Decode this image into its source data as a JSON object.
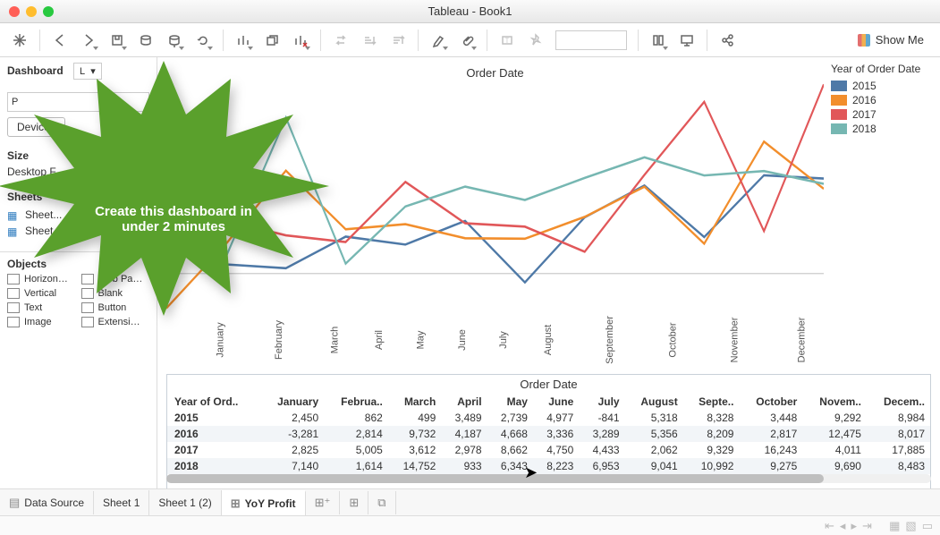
{
  "window": {
    "title": "Tableau - Book1"
  },
  "toolbar": {
    "showme": "Show Me"
  },
  "sidebar": {
    "dashboard_label": "Dashboard",
    "layout_sel": "L",
    "device_btn": "Device .",
    "size_label": "Size",
    "size_value": "Desktop F",
    "sheets_label": "Sheets",
    "sheets": [
      "Sheet...",
      "Sheet 1 (2)"
    ],
    "objects_label": "Objects",
    "objects": [
      "Horizon…",
      "Web Pa…",
      "Vertical",
      "Blank",
      "Text",
      "Button",
      "Image",
      "Extensi…"
    ],
    "preview_label": "P"
  },
  "callout": {
    "text": "Create this dashboard in under 2 minutes"
  },
  "chart_data": {
    "type": "line",
    "title": "Order Date",
    "categories": [
      "January",
      "February",
      "March",
      "April",
      "May",
      "June",
      "July",
      "August",
      "September",
      "October",
      "November",
      "December"
    ],
    "series": [
      {
        "name": "2015",
        "color": "#4e79a7",
        "values": [
          2450,
          862,
          499,
          3489,
          2739,
          4977,
          -841,
          5318,
          8328,
          3448,
          9292,
          8984
        ]
      },
      {
        "name": "2016",
        "color": "#f28e2c",
        "values": [
          -3281,
          2814,
          9732,
          4187,
          4668,
          3336,
          3289,
          5356,
          8209,
          2817,
          12475,
          8017
        ]
      },
      {
        "name": "2017",
        "color": "#e15759",
        "values": [
          2825,
          5005,
          3612,
          2978,
          8662,
          4750,
          4433,
          2062,
          9329,
          16243,
          4011,
          17885
        ]
      },
      {
        "name": "2018",
        "color": "#76b7b2",
        "values": [
          7140,
          1614,
          14752,
          933,
          6343,
          8223,
          6953,
          9041,
          10992,
          9275,
          9690,
          8483
        ]
      }
    ],
    "ylim": [
      -4000,
      18000
    ]
  },
  "table": {
    "title": "Order Date",
    "rowheader": "Year of Ord..",
    "columns": [
      "January",
      "Februa..",
      "March",
      "April",
      "May",
      "June",
      "July",
      "August",
      "Septe..",
      "October",
      "Novem..",
      "Decem.."
    ],
    "rows": [
      {
        "year": "2015",
        "v": [
          "2,450",
          "862",
          "499",
          "3,489",
          "2,739",
          "4,977",
          "-841",
          "5,318",
          "8,328",
          "3,448",
          "9,292",
          "8,984"
        ]
      },
      {
        "year": "2016",
        "v": [
          "-3,281",
          "2,814",
          "9,732",
          "4,187",
          "4,668",
          "3,336",
          "3,289",
          "5,356",
          "8,209",
          "2,817",
          "12,475",
          "8,017"
        ]
      },
      {
        "year": "2017",
        "v": [
          "2,825",
          "5,005",
          "3,612",
          "2,978",
          "8,662",
          "4,750",
          "4,433",
          "2,062",
          "9,329",
          "16,243",
          "4,011",
          "17,885"
        ]
      },
      {
        "year": "2018",
        "v": [
          "7,140",
          "1,614",
          "14,752",
          "933",
          "6,343",
          "8,223",
          "6,953",
          "9,041",
          "10,992",
          "9,275",
          "9,690",
          "8,483"
        ]
      }
    ]
  },
  "tabs": {
    "data_source": "Data Source",
    "items": [
      "Sheet 1",
      "Sheet 1 (2)",
      "YoY Profit"
    ],
    "active": "YoY Profit"
  },
  "legend": {
    "title": "Year of Order Date"
  }
}
